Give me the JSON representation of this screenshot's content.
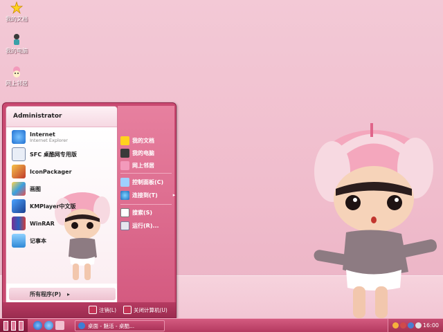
{
  "desktop": {
    "icons": [
      {
        "label": "我的文档",
        "icon": "star-icon"
      },
      {
        "label": "我的电脑",
        "icon": "computer-icon"
      },
      {
        "label": "网上邻居",
        "icon": "network-icon"
      }
    ]
  },
  "start_menu": {
    "user": "Administrator",
    "pinned": [
      {
        "title": "Internet",
        "subtitle": "Internet Explorer",
        "icon": "ie-icon"
      },
      {
        "title": "SFC 桌酷网专用版",
        "icon": "sfc-icon"
      }
    ],
    "programs": [
      {
        "title": "IconPackager",
        "icon": "iconpackager-icon"
      },
      {
        "title": "画图",
        "icon": "paint-icon"
      },
      {
        "title": "KMPlayer中文版",
        "icon": "kmplayer-icon"
      },
      {
        "title": "WinRAR",
        "icon": "winrar-icon"
      },
      {
        "title": "记事本",
        "icon": "notepad-icon"
      }
    ],
    "all_programs": "所有程序(P)",
    "right": [
      {
        "label": "我的文档",
        "icon": "star-icon"
      },
      {
        "label": "我的电脑",
        "icon": "computer-icon"
      },
      {
        "label": "网上邻居",
        "icon": "network-icon"
      },
      {
        "label": "控制面板(C)",
        "icon": "control-panel-icon"
      },
      {
        "label": "连接到(T)",
        "icon": "connect-icon"
      },
      {
        "label": "搜索(S)",
        "icon": "search-icon"
      },
      {
        "label": "运行(R)...",
        "icon": "run-icon"
      }
    ],
    "logoff": "注销(L)",
    "shutdown": "关闭计算机(U)"
  },
  "taskbar": {
    "task_item": "桌面 - 魅活 - 桌酷...",
    "clock": "16:00"
  },
  "colors": {
    "accent": "#c94a71",
    "taskbar": "#b43a60",
    "background": "#f0bccc"
  }
}
